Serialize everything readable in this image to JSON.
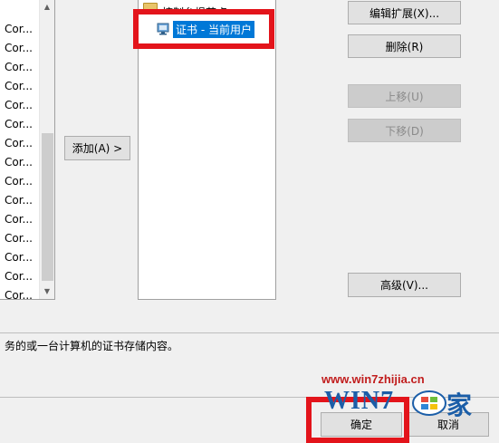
{
  "left_list": {
    "items": [
      "Cor...",
      "Cor...",
      "Cor...",
      "Cor...",
      "Cor...",
      "Cor...",
      "Cor...",
      "Cor...",
      "Cor...",
      "Cor...",
      "Cor...",
      "Cor...",
      "Cor...",
      "Cor...",
      "Cor..."
    ]
  },
  "add_button": "添加(A) >",
  "selected_snapins": {
    "items": [
      {
        "label": "控制台根节点",
        "icon": "folder-icon",
        "selected": false
      },
      {
        "label": "证书 - 当前用户",
        "icon": "certificate-icon",
        "selected": true
      }
    ]
  },
  "side_buttons": {
    "edit_extensions": "编辑扩展(X)...",
    "remove": "删除(R)",
    "move_up": "上移(U)",
    "move_down": "下移(D)",
    "advanced": "高级(V)..."
  },
  "description": {
    "text": "务的或一台计算机的证书存储内容。"
  },
  "footer": {
    "ok": "确定",
    "cancel": "取消"
  },
  "watermark": {
    "url": "www.win7zhijia.cn",
    "logo_text": "WIN7",
    "logo_suffix": "家"
  },
  "colors": {
    "highlight_red": "#e3141b",
    "selection_blue": "#0078d7",
    "watermark_blue": "#1b5ea8",
    "watermark_red": "#c11d1d"
  }
}
